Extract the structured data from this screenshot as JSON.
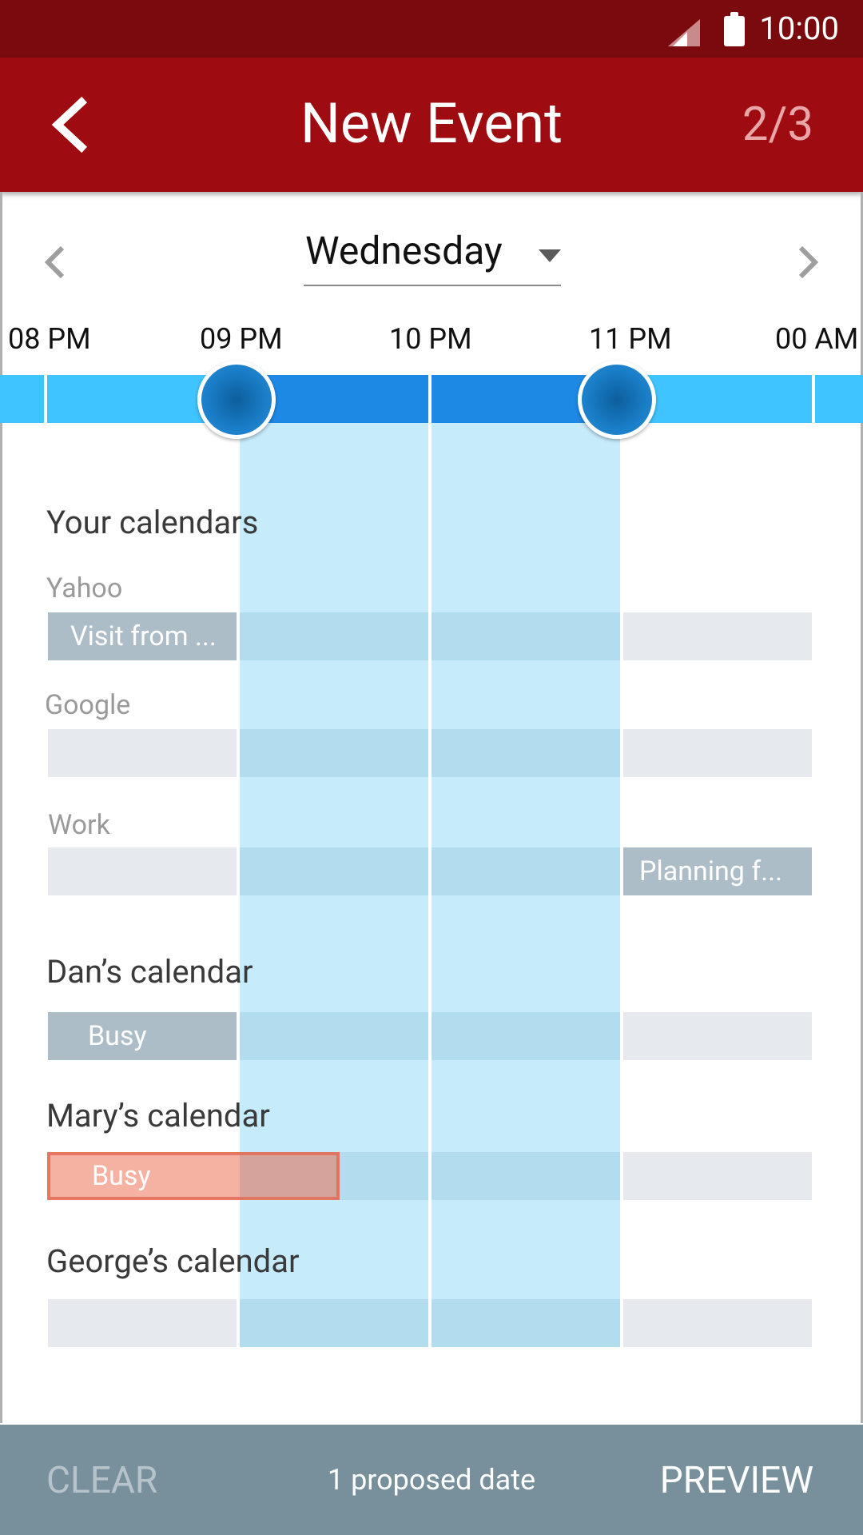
{
  "status_bar": {
    "time": "10:00"
  },
  "app_bar": {
    "title": "New Event",
    "step": "2/3"
  },
  "day_selector": {
    "selected": "Wednesday"
  },
  "timeline": {
    "labels": [
      "08 PM",
      "09 PM",
      "10 PM",
      "11 PM",
      "00 AM"
    ],
    "selected_start": "09 PM",
    "selected_end": "11 PM"
  },
  "calendars": {
    "heading": "Your calendars",
    "yahoo": {
      "name": "Yahoo",
      "event": "Visit from ..."
    },
    "google": {
      "name": "Google"
    },
    "work": {
      "name": "Work",
      "event": "Planning f..."
    }
  },
  "people": {
    "dan": {
      "name": "Dan’s calendar",
      "event": "Busy"
    },
    "mary": {
      "name": "Mary’s calendar",
      "event": "Busy"
    },
    "george": {
      "name": "George’s calendar"
    }
  },
  "bottom_bar": {
    "clear_label": "CLEAR",
    "info": "1 proposed date",
    "preview_label": "PREVIEW"
  },
  "colors": {
    "status_bar": "#7b0a0e",
    "app_bar": "#9e0b11",
    "timeline": "#40c4ff",
    "selected_range": "#1e88e5",
    "highlight": "#c6ebfb",
    "bottom_bar": "#78909c",
    "busy_conflict": "#ee7d64"
  }
}
